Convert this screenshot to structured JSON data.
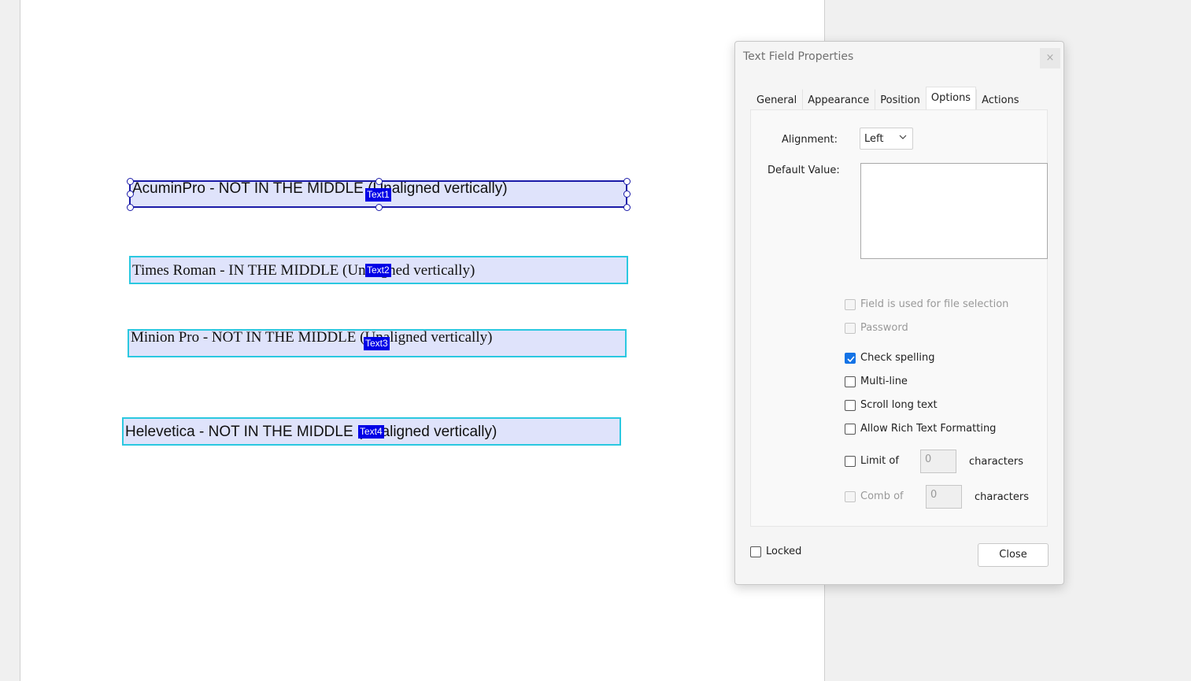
{
  "fields": [
    {
      "text": "AcuminPro - NOT IN THE MIDDLE (Unaligned vertically)",
      "tag": "Text1"
    },
    {
      "text": "Times Roman - IN THE MIDDLE (Unaligned vertically)",
      "tag": "Text2"
    },
    {
      "text": "Minion Pro - NOT IN THE MIDDLE (Unaligned vertically)",
      "tag": "Text3"
    },
    {
      "text": "Helevetica - NOT IN THE MIDDLE (Unaligned vertically)",
      "tag": "Text4"
    }
  ],
  "dialog": {
    "title": "Text Field Properties",
    "close_icon": "×",
    "tabs": [
      "General",
      "Appearance",
      "Position",
      "Options",
      "Actions"
    ],
    "active_tab": "Options",
    "alignment_label": "Alignment:",
    "alignment_value": "Left",
    "default_value_label": "Default Value:",
    "checkboxes": {
      "file_selection": "Field is used for file selection",
      "password": "Password",
      "check_spelling": "Check spelling",
      "multi_line": "Multi-line",
      "scroll_long_text": "Scroll long text",
      "rich_text": "Allow Rich Text Formatting",
      "limit_of": "Limit of",
      "comb_of": "Comb of"
    },
    "limit_value": "0",
    "comb_value": "0",
    "characters_label": "characters",
    "locked_label": "Locked",
    "close_button": "Close"
  },
  "colors": {
    "accent": "#1473e6",
    "field_fill": "#dfe3fb",
    "field_border": "#2bc8e0",
    "tag_bg": "#0000e6"
  }
}
